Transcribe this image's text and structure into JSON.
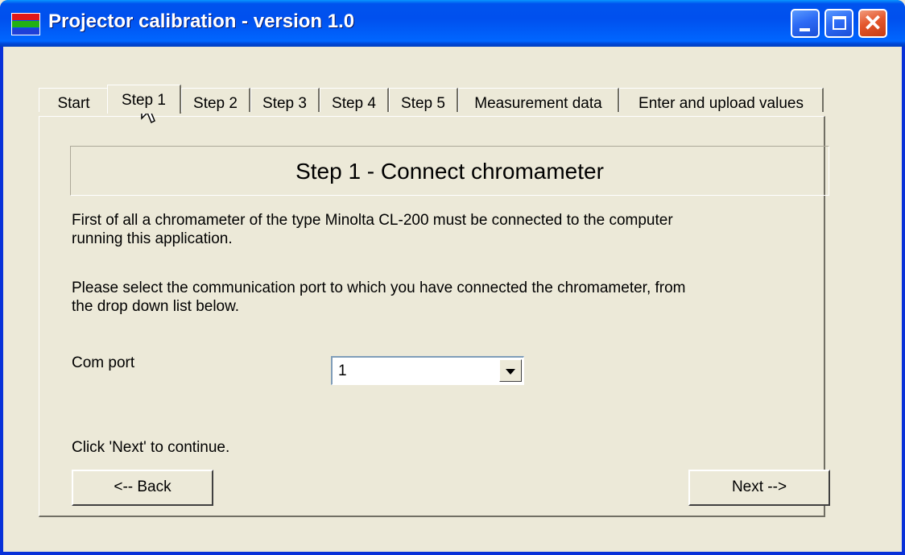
{
  "window": {
    "title": "Projector calibration - version 1.0",
    "icon_colors": [
      "#E01818",
      "#22B014",
      "#1E3FD8"
    ]
  },
  "titlebar_buttons": {
    "close_glyph": "✕"
  },
  "tabs": [
    {
      "label": "Start",
      "active": false
    },
    {
      "label": "Step 1",
      "active": true
    },
    {
      "label": "Step 2",
      "active": false
    },
    {
      "label": "Step 3",
      "active": false
    },
    {
      "label": "Step 4",
      "active": false
    },
    {
      "label": "Step 5",
      "active": false
    },
    {
      "label": "Measurement data",
      "active": false
    },
    {
      "label": "Enter and upload values",
      "active": false
    }
  ],
  "panel": {
    "heading": "Step 1 - Connect chromameter",
    "paragraph1_line1": "First of all a chromameter of the type Minolta CL-200 must be connected to the computer",
    "paragraph1_line2": "running this application.",
    "paragraph2_line1": "Please select the communication port to which you have connected the chromameter, from",
    "paragraph2_line2": "the drop down list below.",
    "com_port_label": "Com port",
    "com_port_value": "1",
    "continue_hint": "Click 'Next' to continue.",
    "back_label": "<-- Back",
    "next_label": "Next -->"
  }
}
